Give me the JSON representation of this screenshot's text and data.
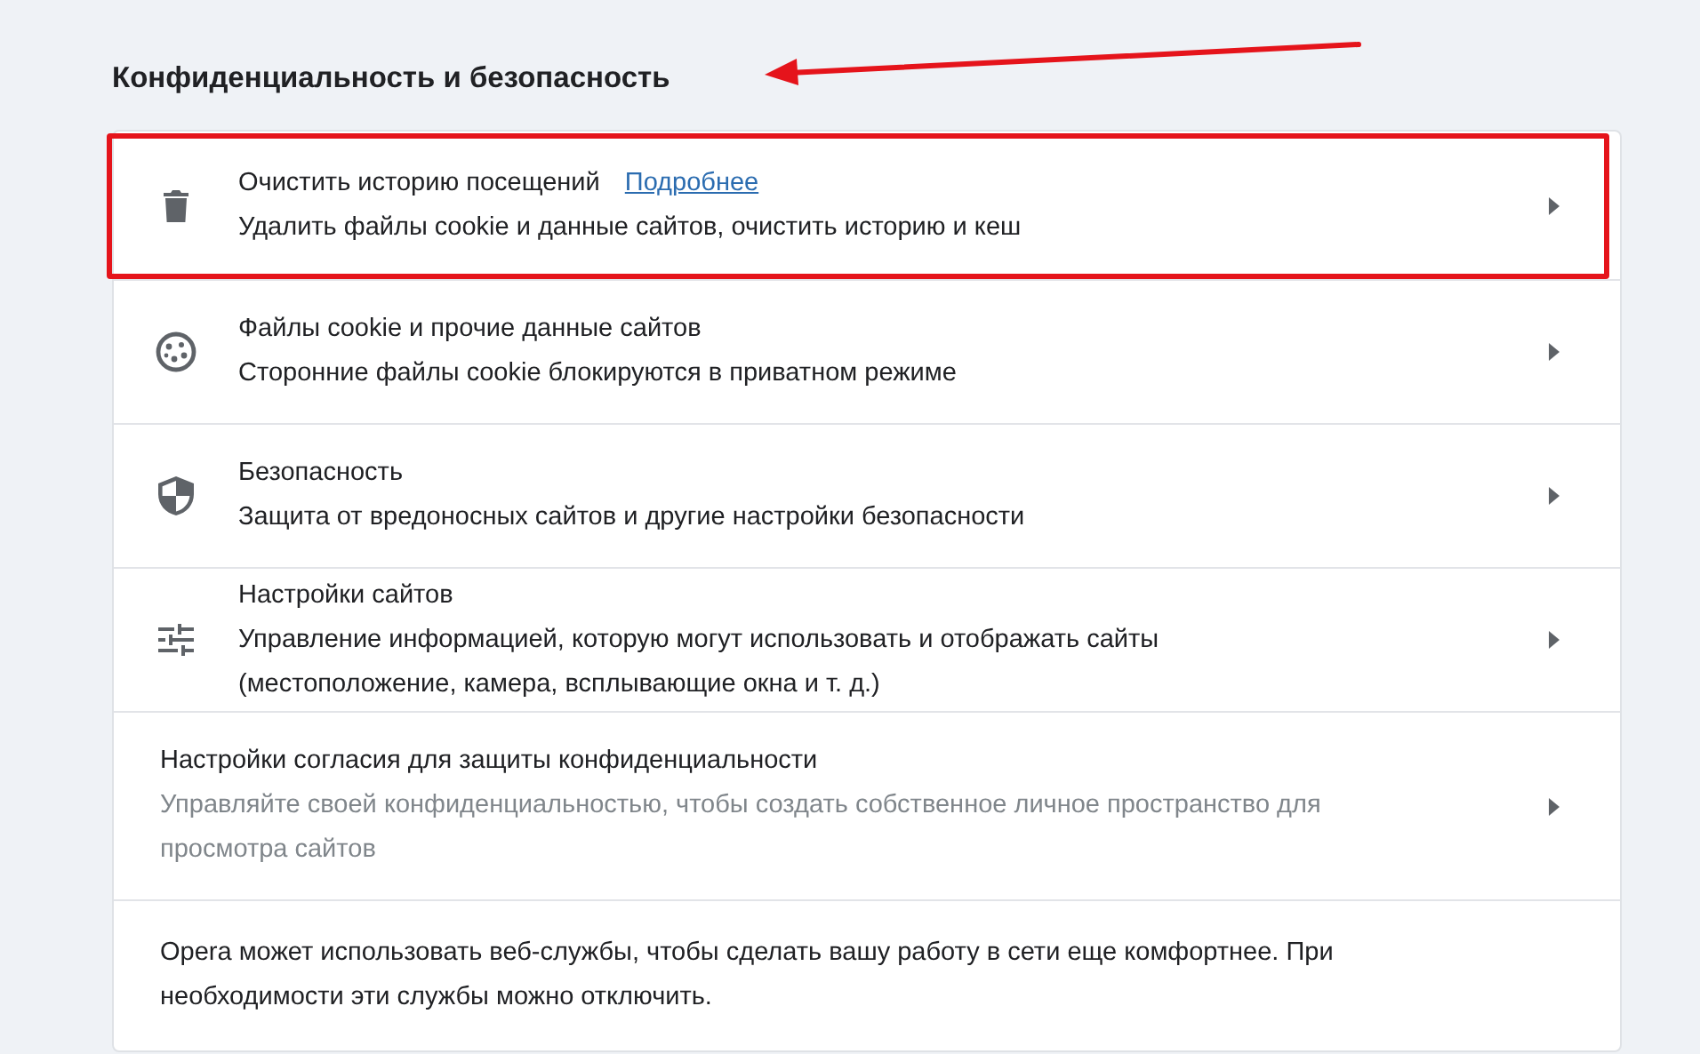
{
  "section": {
    "title": "Конфиденциальность и безопасность"
  },
  "rows": [
    {
      "kind": "link",
      "title": "Очистить историю посещений",
      "link": "Подробнее",
      "subtitle": [
        "Удалить файлы cookie и данные сайтов, очистить историю и кеш"
      ],
      "highlighted": true
    },
    {
      "kind": "link",
      "title": "Файлы cookie и прочие данные сайтов",
      "subtitle": [
        "Сторонние файлы cookie блокируются в приватном режиме"
      ],
      "highlighted": false
    },
    {
      "kind": "link",
      "title": "Безопасность",
      "subtitle": [
        "Защита от вредоносных сайтов и другие настройки безопасности"
      ],
      "highlighted": false
    },
    {
      "kind": "link",
      "title": "Настройки сайтов",
      "subtitle": [
        "Управление информацией, которую могут использовать и отображать сайты",
        "(местоположение, камера, всплывающие окна и т. д.)"
      ],
      "highlighted": false
    },
    {
      "kind": "plain",
      "title": "Настройки согласия для защиты конфиденциальности",
      "subtitle": [
        "Управляйте своей конфиденциальностью, чтобы создать собственное личное пространство для",
        "просмотра сайтов"
      ],
      "highlighted": false
    },
    {
      "kind": "note",
      "text": "Opera может использовать веб-службы, чтобы сделать вашу работу в сети еще комфортнее. При необходимости эти службы можно отключить.",
      "highlighted": false
    }
  ]
}
